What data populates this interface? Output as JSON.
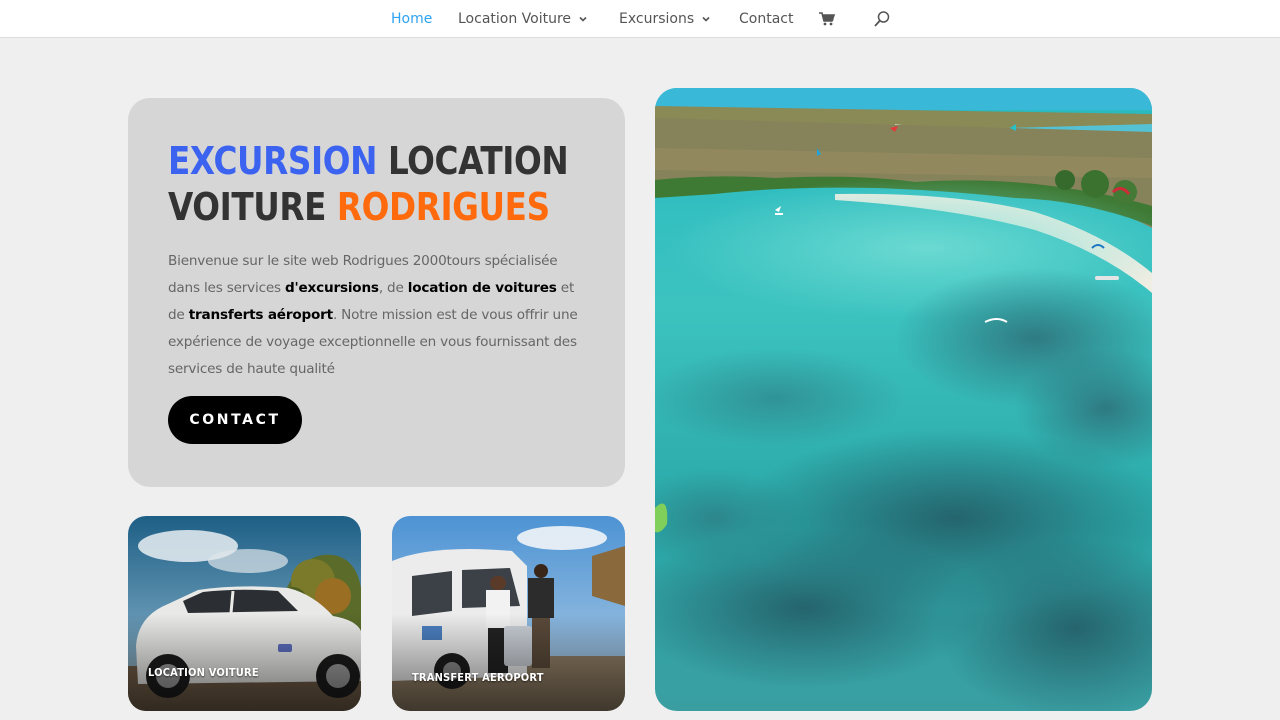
{
  "nav": {
    "items": [
      {
        "label": "Home",
        "active": true,
        "has_dropdown": false
      },
      {
        "label": "Location Voiture",
        "active": false,
        "has_dropdown": true
      },
      {
        "label": "Excursions",
        "active": false,
        "has_dropdown": true
      },
      {
        "label": "Contact",
        "active": false,
        "has_dropdown": false
      }
    ],
    "cart_icon": "cart-icon",
    "search_icon": "search-icon"
  },
  "hero": {
    "title": {
      "word1": "EXCURSION",
      "word2": "LOCATION",
      "word3": "VOITURE",
      "word4": "RODRIGUES"
    },
    "text": {
      "p1": "Bienvenue sur le site web Rodrigues 2000tours spécialisée dans les services ",
      "b1": "d'excursions",
      "p2": ", de ",
      "b2": "location de voitures",
      "p3": " et de ",
      "b3": "transferts aéroport",
      "p4": ". Notre mission est de vous offrir une expérience de voyage exceptionnelle en vous fournissant des services de haute qualité"
    },
    "button_label": "CONTACT"
  },
  "tiles": [
    {
      "label": "LOCATION VOITURE",
      "image": "white-suv-photo"
    },
    {
      "label": "TRANSFERT AEROPORT",
      "image": "airport-van-photo"
    }
  ],
  "main_image": "beach-lagoon-aerial-photo",
  "colors": {
    "nav_active": "#2ea3f2",
    "title_blue": "#3b63f0",
    "title_orange": "#ff6a0d",
    "card_bg": "#d6d6d6",
    "button_bg": "#000000"
  }
}
